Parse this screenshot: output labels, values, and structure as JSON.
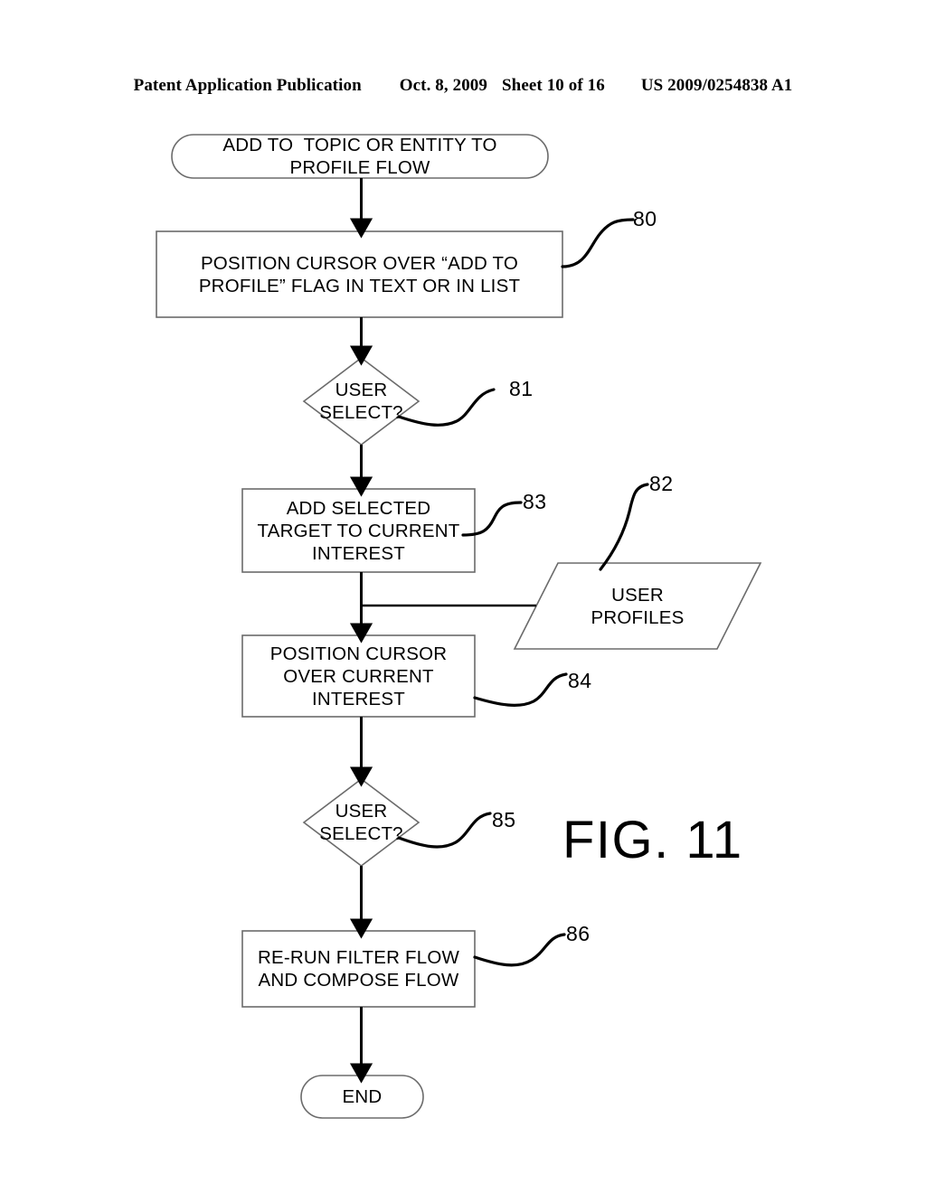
{
  "header": {
    "publication": "Patent Application Publication",
    "date": "Oct. 8, 2009",
    "sheet": "Sheet 10 of 16",
    "patent_number": "US 2009/0254838 A1"
  },
  "figure": {
    "label": "FIG. 11"
  },
  "nodes": {
    "start": {
      "shape": "terminator",
      "line1": "ADD TO  TOPIC OR ENTITY TO",
      "line2": "PROFILE FLOW"
    },
    "box_80": {
      "shape": "process",
      "ref": "80",
      "line1": "POSITION CURSOR OVER “ADD TO",
      "line2": "PROFILE” FLAG IN TEXT OR IN LIST"
    },
    "decision_81": {
      "shape": "decision",
      "ref": "81",
      "line1": "USER",
      "line2": "SELECT?"
    },
    "box_83": {
      "shape": "process",
      "ref": "83",
      "line1": "ADD SELECTED",
      "line2": "TARGET TO CURRENT",
      "line3": "INTEREST"
    },
    "data_82": {
      "shape": "data-parallelogram",
      "ref": "82",
      "line1": "USER",
      "line2": "PROFILES"
    },
    "box_84": {
      "shape": "process",
      "ref": "84",
      "line1": "POSITION CURSOR",
      "line2": "OVER CURRENT",
      "line3": "INTEREST"
    },
    "decision_85": {
      "shape": "decision",
      "ref": "85",
      "line1": "USER",
      "line2": "SELECT?"
    },
    "box_86": {
      "shape": "process",
      "ref": "86",
      "line1": "RE-RUN FILTER FLOW",
      "line2": "AND COMPOSE FLOW"
    },
    "end": {
      "shape": "terminator",
      "line1": "END"
    }
  },
  "colors": {
    "stroke": "#000000",
    "shape_outline": "#6b6b6b",
    "background": "#ffffff"
  }
}
